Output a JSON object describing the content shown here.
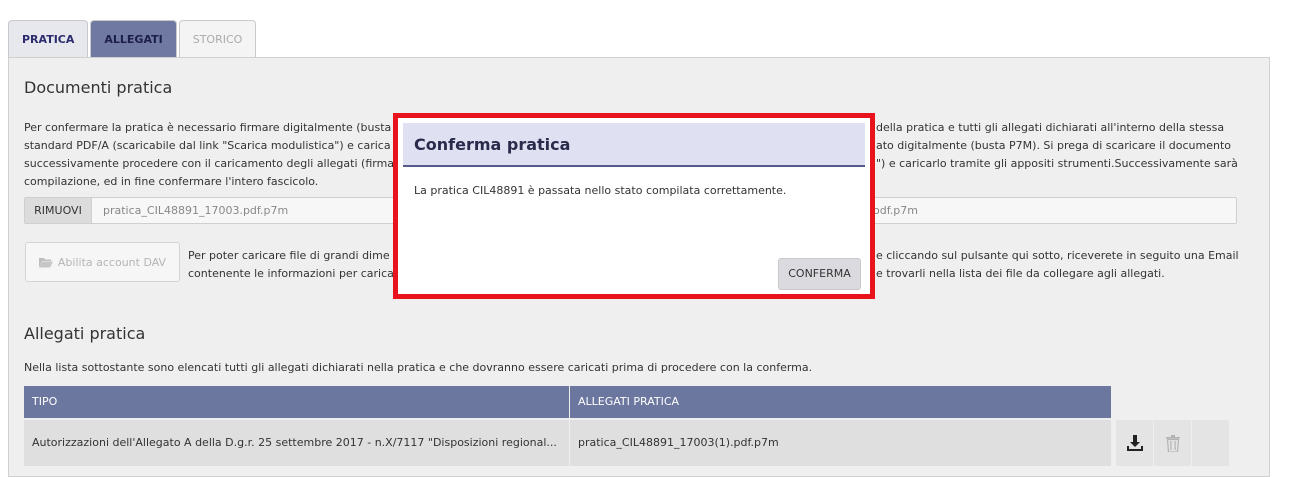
{
  "tabs": [
    {
      "label": "PRATICA"
    },
    {
      "label": "ALLEGATI"
    },
    {
      "label": "STORICO"
    }
  ],
  "documents": {
    "title": "Documenti pratica",
    "paragraph_lines": [
      "Per confermare la pratica è necessario firmare digitalmente (busta P",
      "standard PDF/A (scaricabile dal link \"Scarica modulistica\") e carica",
      "successivamente procedere con il caricamento degli allegati (firmat",
      "compilazione, ed in fine confermare l'intero fascicolo."
    ],
    "paragraph_lines_right": [
      "della pratica e tutti gli allegati dichiarati all'interno della stessa",
      "ato digitalmente (busta P7M). Si prega di scaricare il documento",
      "\") e caricarlo tramite gli appositi strumenti.Successivamente sarà"
    ],
    "remove_label": "RIMUOVI",
    "file_name": "pratica_CIL48891_17003.pdf.p7m",
    "file_name_right": "odf.p7m",
    "dav_button_label": "Abilita account DAV",
    "dav_lines": [
      "Per poter caricare file di grandi dime",
      "contenente le informazioni per carica"
    ],
    "dav_lines_right": [
      "e cliccando sul pulsante qui sotto, riceverete in seguito una Email",
      "e trovarli nella lista dei file da collegare agli allegati."
    ]
  },
  "attachments": {
    "title": "Allegati pratica",
    "description": "Nella lista sottostante sono elencati tutti gli allegati dichiarati nella pratica e che dovranno essere caricati prima di procedere con la conferma.",
    "columns": [
      "TIPO",
      "ALLEGATI PRATICA"
    ],
    "rows": [
      {
        "tipo": "Autorizzazioni dell'Allegato A della D.g.r. 25 settembre 2017 - n.X/7117 \"Disposizioni regional...",
        "file": "pratica_CIL48891_17003(1).pdf.p7m"
      }
    ]
  },
  "modal": {
    "title": "Conferma pratica",
    "message": "La pratica CIL48891 è passata nello stato compilata correttamente.",
    "confirm_label": "CONFERMA"
  },
  "colors": {
    "accent": "#6c77a0",
    "highlight_border": "#e8131c"
  }
}
